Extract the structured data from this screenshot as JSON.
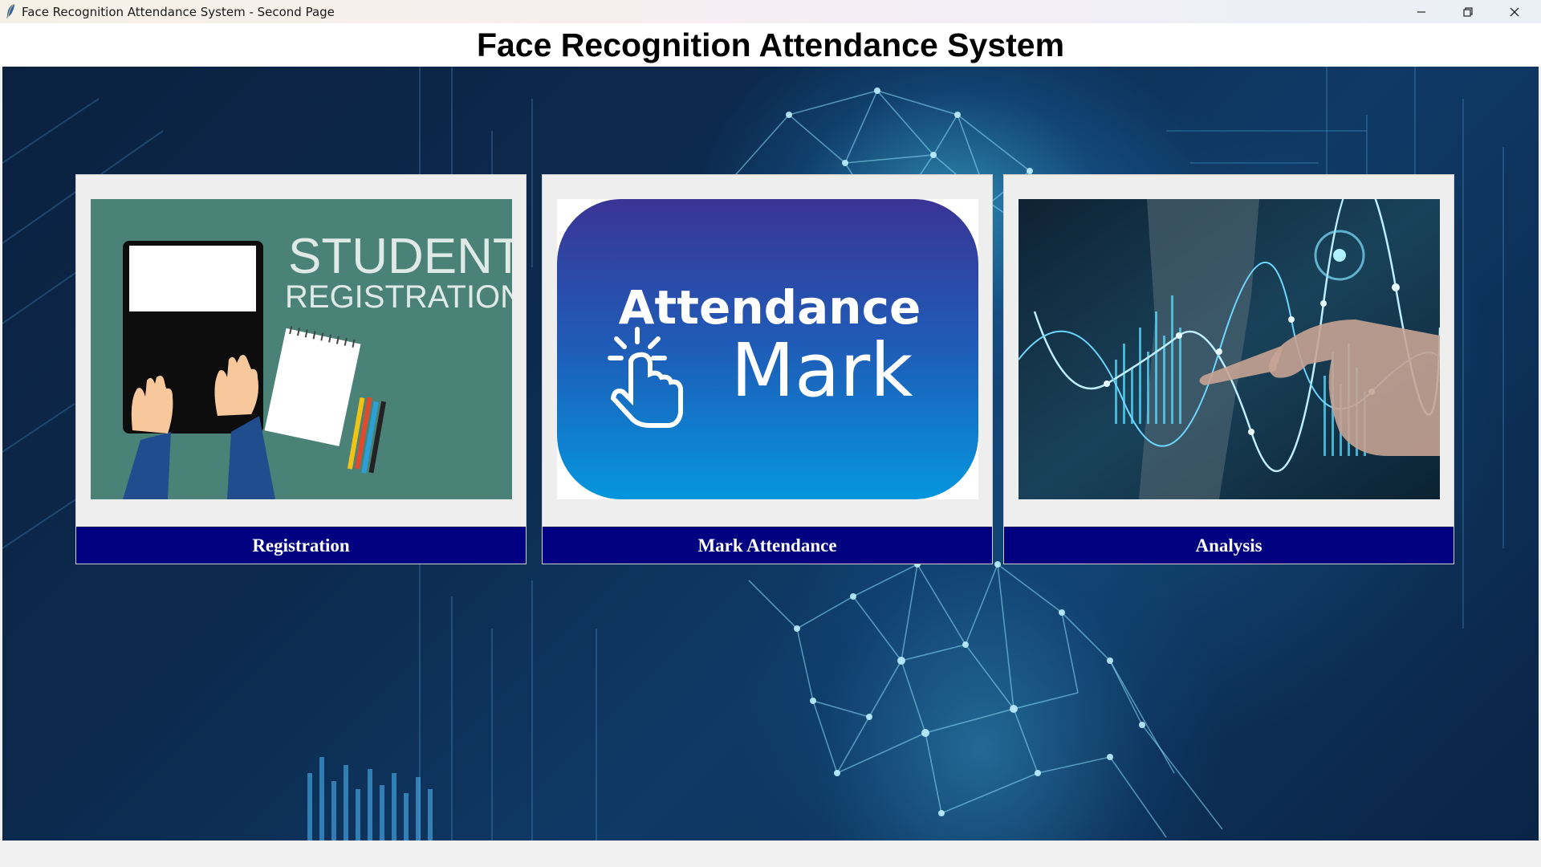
{
  "window": {
    "title": "Face Recognition Attendance System - Second Page",
    "controls": [
      "minimize",
      "maximize",
      "close"
    ]
  },
  "header": {
    "title": "Face Recognition Attendance System"
  },
  "cards": [
    {
      "label": "Registration",
      "image_text_line1": "STUDENT",
      "image_text_line2": "REGISTRATION"
    },
    {
      "label": "Mark Attendance",
      "image_text_line1": "Attendance",
      "image_text_line2": "Mark"
    },
    {
      "label": "Analysis"
    }
  ],
  "colors": {
    "button_bg": "#000080",
    "button_text": "#ffffff",
    "card_bg": "#eeeeee",
    "hero_bg": "#0c2a4e",
    "registration_image_bg": "#4a8278",
    "attendance_image_top": "#3a3495",
    "attendance_image_bottom": "#0596dd"
  },
  "icons": [
    "feather-icon",
    "minimize-icon",
    "maximize-icon",
    "close-icon",
    "hand-pointer-icon"
  ]
}
